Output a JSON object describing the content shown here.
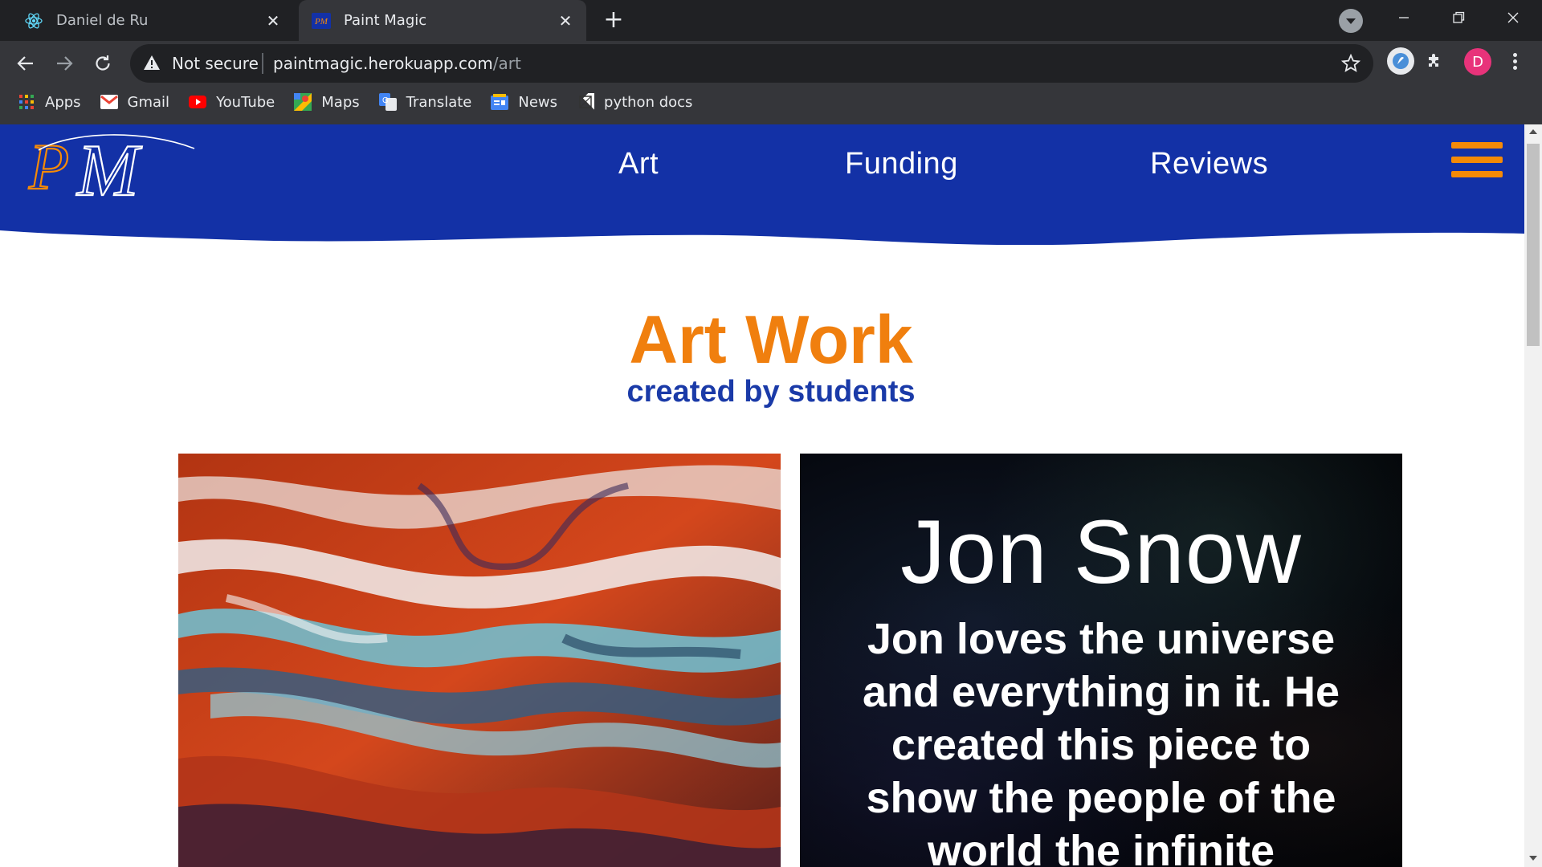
{
  "browser": {
    "tabs": [
      {
        "title": "Daniel de Ru",
        "icon": "react-icon",
        "active": false
      },
      {
        "title": "Paint Magic",
        "icon": "paint-magic-favicon",
        "active": true
      }
    ],
    "security_label": "Not secure",
    "url_host": "paintmagic.herokuapp.com",
    "url_path": "/art",
    "profile_initial": "D",
    "bookmarks": [
      {
        "label": "Apps",
        "icon": "apps-grid-icon"
      },
      {
        "label": "Gmail",
        "icon": "gmail-icon"
      },
      {
        "label": "YouTube",
        "icon": "youtube-icon"
      },
      {
        "label": "Maps",
        "icon": "maps-icon"
      },
      {
        "label": "Translate",
        "icon": "translate-icon"
      },
      {
        "label": "News",
        "icon": "news-icon"
      },
      {
        "label": "python docs",
        "icon": "python-docs-icon"
      }
    ]
  },
  "site": {
    "logo_text": "PM",
    "nav": {
      "art": "Art",
      "funding": "Funding",
      "reviews": "Reviews"
    },
    "colors": {
      "header_blue": "#1331a6",
      "accent_orange": "#f07f0e",
      "subtitle_blue": "#1a3aa8"
    }
  },
  "main": {
    "title": "Art Work",
    "subtitle": "created by students",
    "artist_card": {
      "name": "Jon Snow",
      "bio": "Jon loves the universe and everything in it. He created this piece to show the people of the world the infinite"
    }
  }
}
